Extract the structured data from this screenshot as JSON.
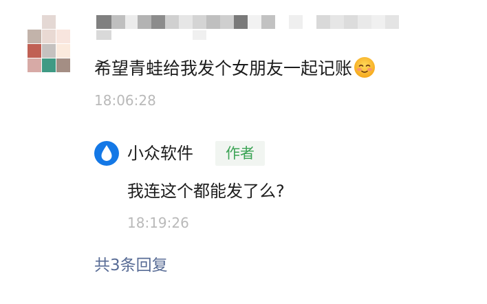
{
  "comment": {
    "text": "希望青蛙给我发个女朋友一起记账",
    "emoji": "smiling-face-icon",
    "time": "18:06:28"
  },
  "reply": {
    "author_name": "小众软件",
    "author_badge": "作者",
    "avatar_icon": "water-drop-icon",
    "text": "我连这个都能发了么?",
    "time": "18:19:26"
  },
  "more_replies_label": "共3条回复",
  "colors": {
    "link": "#576b95",
    "badge_text": "#3aa354",
    "badge_bg": "#f1f5f1",
    "timestamp": "#b9b9b9",
    "reply_avatar": "#1478e6"
  }
}
